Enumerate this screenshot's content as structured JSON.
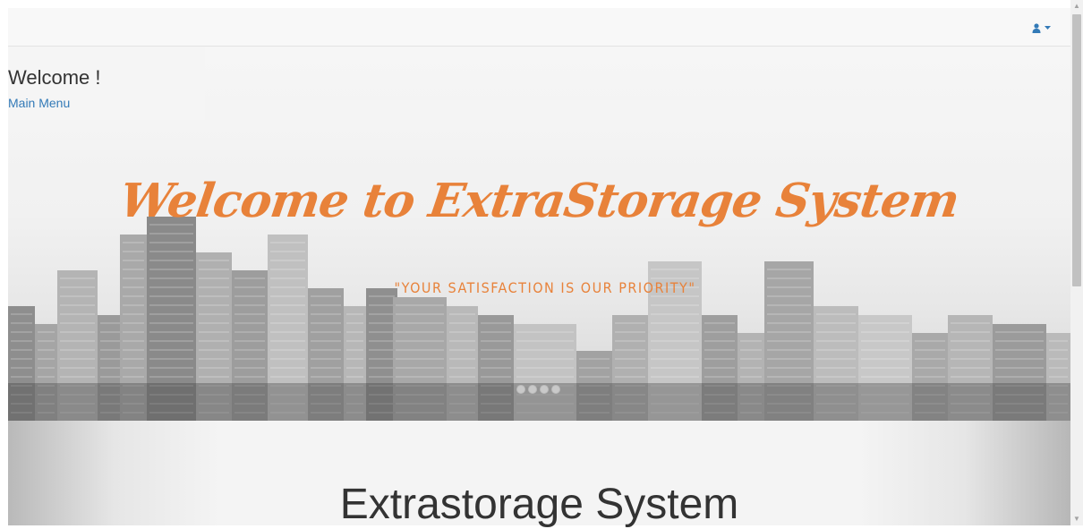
{
  "navbar": {
    "user_menu_icon": "user-icon",
    "caret_icon": "caret-down-icon"
  },
  "sidebar": {
    "welcome": "Welcome !",
    "main_menu_link": "Main Menu"
  },
  "hero": {
    "title": "Welcome to ExtraStorage System",
    "tagline": "\"YOUR SATISFACTION IS OUR PRIORITY\"",
    "carousel_indicator_count": 4
  },
  "section": {
    "title": "Extrastorage System"
  },
  "colors": {
    "accent_orange": "#e8823a",
    "link_blue": "#337ab7",
    "user_icon_blue": "#337ab7"
  },
  "scrollbar": {
    "up_icon": "scroll-up-arrow-icon",
    "down_icon": "scroll-down-arrow-icon"
  }
}
